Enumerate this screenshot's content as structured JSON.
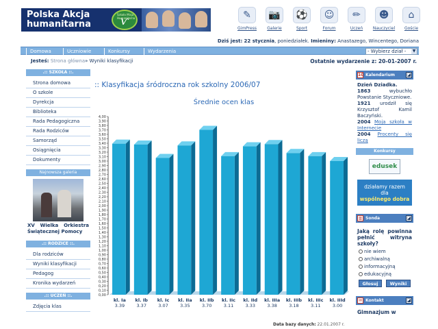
{
  "header": {
    "logo_line1": "Polska Akcja",
    "logo_line2": "humanitarna",
    "logo_badge_small": "Szkoła Misja Humanitarna",
    "icons": [
      {
        "name": "gimpress-icon",
        "label": "GimPress"
      },
      {
        "name": "galerie-icon",
        "label": "Galerie"
      },
      {
        "name": "sport-icon",
        "label": "Sport"
      },
      {
        "name": "forum-icon",
        "label": "Forum"
      },
      {
        "name": "uczen-icon",
        "label": "Uczeń"
      },
      {
        "name": "nauczyciel-icon",
        "label": "Nauczyciel"
      },
      {
        "name": "goscie-icon",
        "label": "Goście"
      }
    ]
  },
  "dateline": {
    "today_label": "Dziś jest:",
    "today_value": "22 stycznia",
    "day": ", poniedziałek.",
    "names_label": "Imieniny:",
    "names_value": "Anastazego, Wincentego, Doriana"
  },
  "nav": {
    "items": [
      "Domowa",
      "Uczniowie",
      "Konkursy",
      "Wydarzenia"
    ],
    "select_value": "- Wybierz dział -"
  },
  "breadcrumb": {
    "label": "Jesteś:",
    "home": "Strona główna",
    "sep": "»",
    "current": "Wyniki klasyfikacji"
  },
  "last_event": "Ostatnie wydarzenie z: 20-01-2007 r.",
  "left": {
    "school_head": ".:: SZKOŁA ::.",
    "school_items": [
      "Strona domowa",
      "O szkole",
      "Dyrekcja",
      "Biblioteka",
      "Rada Pedagogiczna",
      "Rada Rodziców",
      "Samorząd",
      "Osiągnięcia",
      "Dokumenty"
    ],
    "gallery_head": "Najnowsza galeria",
    "gallery_caption": "XV Wielka Orkiestra Świątecznej Pomocy",
    "parents_head": ".:: RODZICE ::.",
    "parents_items": [
      "Dla rodziców",
      "Wyniki klasyfikacji",
      "Pedagog",
      "Kronika wydarzeń"
    ],
    "student_head": ".:: UCZEŃ ::.",
    "student_items": [
      "Zdjęcia klas"
    ]
  },
  "main": {
    "title": ":: Klasyfikacja śródroczna rok szkolny 2006/07",
    "chart_title": "Średnie ocen klas",
    "footer_label": "Data bazy danych:",
    "footer_value": "22.01.2007 r."
  },
  "chart_data": {
    "type": "bar",
    "title": "Średnie ocen klas",
    "categories": [
      "kl. Ia",
      "kl. Ib",
      "kl. Ic",
      "kl. IIa",
      "kl. IIb",
      "kl. IIc",
      "kl. IId",
      "kl. IIIa",
      "kl. IIIb",
      "kl. IIIc",
      "kl. IIId"
    ],
    "values": [
      3.39,
      3.37,
      3.07,
      3.35,
      3.7,
      3.11,
      3.33,
      3.38,
      3.18,
      3.11,
      3.0
    ],
    "value_labels": [
      "3.39",
      "3.37",
      "3.07",
      "3.35",
      "3.70",
      "3.11",
      "3.33",
      "3.38",
      "3.18",
      "3.11",
      "3.00"
    ],
    "ylim": [
      0,
      4.0
    ],
    "ytick_step": 0.1,
    "grid": false,
    "bar_color": "#1ea7d4"
  },
  "right": {
    "calendar_head": "Kalendarium",
    "calendar_title": "Dzień Dziadka.",
    "cal1_year": "1863",
    "cal1_text": "wybuchło Powstanie Styczniowe.",
    "cal2_year": "1921",
    "cal2_text": "urodził się Krzysztof Kamil Baczyński.",
    "cal3_year": "2004",
    "cal3_link": "Moja szkoła w Internecie",
    "cal4_year": "2004",
    "cal4_link": "Procenty się liczą",
    "konkursy_head": "Konkursy",
    "banner1": "edusek",
    "banner2_line1": "działamy razem",
    "banner2_line2": "dla",
    "banner2_line3": "wspólnego dobra",
    "sonda_head": "Sonda",
    "sonda_question": "Jaką rolę powinna pełnić witryna szkoły?",
    "sonda_options": [
      "nie wiem",
      "archiwalną",
      "informacyjną",
      "edukacyjną"
    ],
    "vote_button": "Głosuj",
    "results_button": "Wyniki",
    "kontakt_head": "Kontakt",
    "kontakt_text": "Gimnazjum w"
  }
}
